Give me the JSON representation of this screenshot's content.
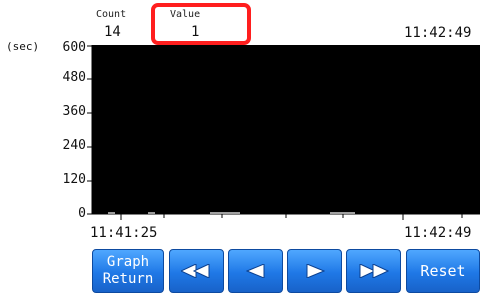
{
  "header": {
    "count_label": "Count",
    "count_value": "14",
    "value_label": "Value",
    "value_value": "1",
    "time_top": "11:42:49"
  },
  "chart": {
    "unit": "(sec)",
    "y_ticks": [
      "600",
      "480",
      "360",
      "240",
      "120",
      "0"
    ],
    "x_start": "11:41:25",
    "x_end": "11:42:49"
  },
  "chart_data": {
    "type": "bar",
    "ylabel": "(sec)",
    "ylim": [
      0,
      600
    ],
    "y_ticks": [
      0,
      120,
      240,
      360,
      480,
      600
    ],
    "x_range": [
      "11:41:25",
      "11:42:49"
    ],
    "grid": false,
    "background": "#000000"
  },
  "buttons": {
    "graph_return_line1": "Graph",
    "graph_return_line2": "Return",
    "reset": "Reset"
  },
  "colors": {
    "highlight": "#ff1e1e",
    "button": "#1f78e6",
    "plot_bg": "#000000"
  },
  "icons": {
    "fast_back": "double-left-triangle-icon",
    "back": "left-triangle-icon",
    "forward": "right-triangle-icon",
    "fast_forward": "double-right-triangle-icon"
  }
}
